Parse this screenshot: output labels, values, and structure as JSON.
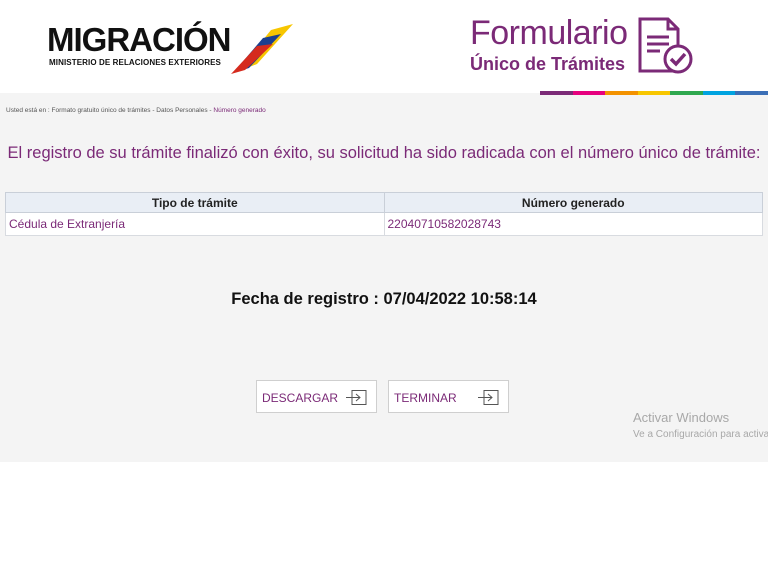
{
  "header": {
    "logo_word": "MIGRACIÓN",
    "logo_sub": "MINISTERIO DE RELACIONES EXTERIORES",
    "form_title": "Formulario",
    "form_subtitle": "Único de Trámites",
    "rainbow_colors": [
      "#7b2a77",
      "#e6007e",
      "#f39200",
      "#f7c600",
      "#2fa84f",
      "#00a3e0",
      "#3b6fb6"
    ]
  },
  "breadcrumb": {
    "path": "Usted está en : Formato gratuito único de trámites - Datos Personales - ",
    "current": "Número generado"
  },
  "success_message": "El registro de su trámite finalizó con éxito, su solicitud ha sido radicada con el número único de trámite:",
  "table": {
    "headers": [
      "Tipo de trámite",
      "Número generado"
    ],
    "rows": [
      [
        "Cédula de Extranjería",
        "22040710582028743"
      ]
    ]
  },
  "fecha_registro": "Fecha de registro : 07/04/2022 10:58:14",
  "buttons": {
    "descargar": "DESCARGAR",
    "terminar": "TERMINAR"
  },
  "activate_windows": {
    "title": "Activar Windows",
    "subtitle": "Ve a Configuración para activar Windows."
  },
  "colors": {
    "brand_purple": "#7b2a77",
    "background": "#f4f4f4"
  }
}
